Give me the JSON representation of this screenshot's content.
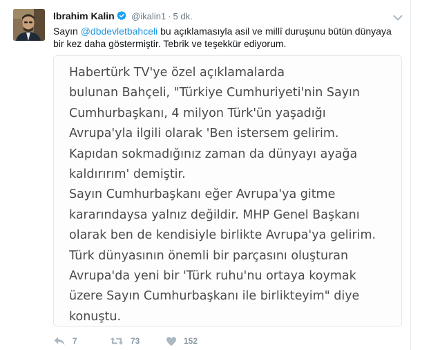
{
  "tweet": {
    "author": {
      "name": "Ibrahim Kalin",
      "handle": "@ikalin1",
      "time": "5 dk."
    },
    "text": {
      "prefix": "Sayın ",
      "mention": "@dbdevletbahceli",
      "suffix": " bu açıklamasıyla asil ve millî duruşunu bütün dünyaya bir kez daha göstermiştir. Tebrik ve teşekkür ediyorum."
    },
    "media": {
      "lines": [
        "Habertürk TV'ye özel açıklamalarda",
        "bulunan Bahçeli, \"Türkiye Cumhuriyeti'nin Sayın",
        "Cumhurbaşkanı, 4 milyon Türk'ün yaşadığı",
        "Avrupa'yla ilgili olarak 'Ben istersem gelirim.",
        "Kapıdan sokmadığınız zaman da dünyayı ayağa",
        "kaldırırım' demiştir.",
        "Sayın Cumhurbaşkanı eğer Avrupa'ya gitme",
        "kararındaysa yalnız değildir. MHP Genel Başkanı",
        "olarak ben de kendisiyle birlikte Avrupa'ya gelirim.",
        "Türk dünyasının önemli bir parçasını oluşturan",
        "Avrupa'da yeni bir 'Türk ruhu'nu ortaya koymak",
        "üzere Sayın Cumhurbaşkanı ile birlikteyim\" diye",
        "konuştu."
      ]
    },
    "actions": {
      "reply_count": "7",
      "retweet_count": "73",
      "like_count": "152"
    },
    "icons": {
      "verified": "verified-badge-icon",
      "caret": "chevron-down-icon",
      "reply": "reply-icon",
      "retweet": "retweet-icon",
      "like": "heart-icon"
    },
    "colors": {
      "link": "#1b95e0",
      "muted": "#657786",
      "action": "#aab8c2"
    }
  }
}
